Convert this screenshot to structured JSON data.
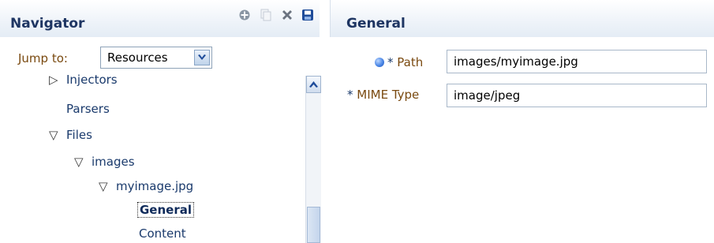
{
  "navigator": {
    "title": "Navigator",
    "toolbar": [
      "add-icon",
      "copy-icon",
      "delete-icon",
      "save-icon"
    ],
    "jump_to": {
      "label": "Jump to:",
      "value": "Resources"
    },
    "tree": [
      {
        "label": "Injectors",
        "twisty": "▷"
      },
      {
        "label": "Parsers",
        "twisty": ""
      },
      {
        "label": "Files",
        "twisty": "▽"
      },
      {
        "label": "images",
        "twisty": "▽"
      },
      {
        "label": "myimage.jpg",
        "twisty": "▽"
      },
      {
        "label": "General",
        "twisty": "",
        "selected": true
      },
      {
        "label": "Content",
        "twisty": ""
      }
    ]
  },
  "general": {
    "title": "General",
    "path": {
      "label": "Path",
      "required_mark": "*",
      "value": "images/myimage.jpg"
    },
    "mime": {
      "label": "MIME Type",
      "required_mark": "*",
      "value": "image/jpeg"
    }
  },
  "colors": {
    "label_brown": "#7a4a10",
    "link_blue": "#1a3a6c",
    "header_bg": "#e4ecf5"
  }
}
